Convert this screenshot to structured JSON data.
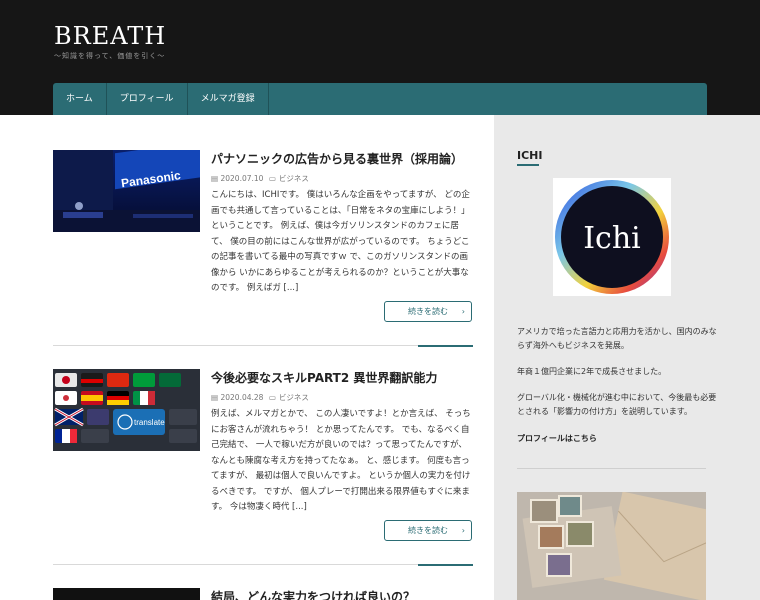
{
  "header": {
    "site_title": "BREATH",
    "tagline": "〜知識を得って、価値を引く〜"
  },
  "nav": {
    "items": [
      {
        "label": "ホーム"
      },
      {
        "label": "プロフィール"
      },
      {
        "label": "メルマガ登録"
      }
    ]
  },
  "posts": [
    {
      "title": "パナソニックの広告から見る裏世界（採用論）",
      "date": "2020.07.10",
      "category": "ビジネス",
      "excerpt": "こんにちは、ICHIです。 僕はいろんな企画をやってますが、 どの企画でも共通して言っていることは、「日常をネタの宝庫にしよう！」ということです。 例えば、僕は今ガソリンスタンドのカフェに居て、 僕の目の前にはこんな世界が広がっているのです。 ちょうどこの記事を書いてる最中の写真ですｗ で、このガソリンスタンドの画像から いかにあらゆることが考えられるのか？ということが大事なのです。 例えばガ [...]",
      "read_more": "続きを読む",
      "thumb_text": "Panasonic"
    },
    {
      "title": "今後必要なスキルPART2 異世界翻訳能力",
      "date": "2020.04.28",
      "category": "ビジネス",
      "excerpt": "例えば、メルマガとかで、 この人凄いですよ！とか言えば、 そっちにお客さんが流れちゃう！ とか思ってたんです。 でも、なるべく自己完結で、 一人で稼いだ方が良いのでは？って思ってたんですが、なんとも陳腐な考え方を持ってたなぁ。 と、感じます。 何度も言ってますが、 最初は個人で良いんですよ。 というか個人の実力を付けるべきです。 ですが、 個人プレーで打開出来る限界値もすぐに来ます。 今は物凄く時代 [...]",
      "read_more": "続きを読む",
      "thumb_text": "translate"
    },
    {
      "title": "結局、どんな実力をつければ良いの？"
    }
  ],
  "sidebar": {
    "title": "ICHI",
    "logo_text": "Ichi",
    "bio_1": "アメリカで培った言語力と応用力を活かし、国内のみならず海外へもビジネスを発展。",
    "bio_2": "年商１億円企業に2年で成長させました。",
    "bio_3": "グローバル化・機械化が進む中において、今後最も必要とされる「影響力の付け方」を説明しています。",
    "profile_link": "プロフィールはこちら"
  },
  "colors": {
    "accent": "#2b6c74",
    "header_bg": "#161616"
  }
}
